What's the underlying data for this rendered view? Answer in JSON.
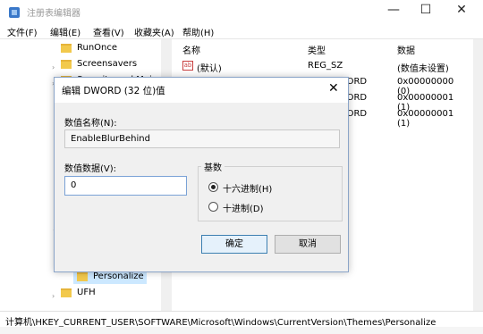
{
  "window": {
    "title": "注册表编辑器"
  },
  "menu": [
    "文件(F)",
    "编辑(E)",
    "查看(V)",
    "收藏夹(A)",
    "帮助(H)"
  ],
  "tree": {
    "items": [
      {
        "label": "RunOnce"
      },
      {
        "label": "Screensavers"
      },
      {
        "label": "Security and Main"
      },
      {
        "label": "Personalize"
      },
      {
        "label": "UFH"
      }
    ]
  },
  "list": {
    "headers": {
      "name": "名称",
      "type": "类型",
      "data": "数据"
    },
    "rows": [
      {
        "name": "(默认)",
        "type": "REG_SZ",
        "data": "(数值未设置)"
      },
      {
        "name": "",
        "type": "DWORD",
        "data": "0x00000000 (0)"
      },
      {
        "name": "",
        "type": "DWORD",
        "data": "0x00000001 (1)"
      },
      {
        "name": "",
        "type": "DWORD",
        "data": "0x00000001 (1)"
      }
    ]
  },
  "status": {
    "path": "计算机\\HKEY_CURRENT_USER\\SOFTWARE\\Microsoft\\Windows\\CurrentVersion\\Themes\\Personalize"
  },
  "dialog": {
    "title": "编辑 DWORD (32 位)值",
    "name_label": "数值名称(N):",
    "name_value": "EnableBlurBehind",
    "data_label": "数值数据(V):",
    "data_value": "0",
    "base_label": "基数",
    "hex_label": "十六进制(H)",
    "dec_label": "十进制(D)",
    "base_selected": "hex",
    "ok_label": "确定",
    "cancel_label": "取消"
  }
}
